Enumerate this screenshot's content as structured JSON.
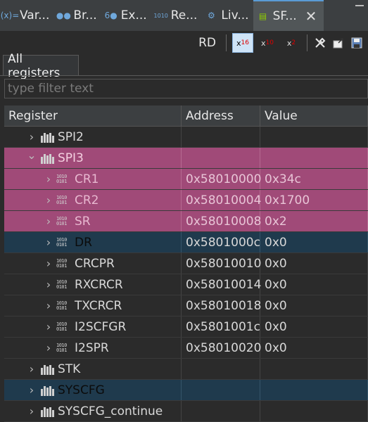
{
  "tabs": [
    {
      "label": "Var...",
      "icon": "(x)=",
      "active": false
    },
    {
      "label": "Br...",
      "icon": "●●",
      "active": false
    },
    {
      "label": "Ex...",
      "icon": "6●",
      "active": false
    },
    {
      "label": "Re...",
      "icon": "1010",
      "active": false
    },
    {
      "label": "Liv...",
      "icon": "⚙",
      "active": false
    },
    {
      "label": "SF...",
      "icon": "▤",
      "active": true
    }
  ],
  "toolbar": {
    "rd_label": "RD",
    "hex_label": "x",
    "hex_sub": "16",
    "dec_label": "x",
    "dec_sub": "10",
    "bin_label": "x",
    "bin_sub": "2"
  },
  "subtab": {
    "label": "All registers"
  },
  "filter": {
    "placeholder": "type filter text"
  },
  "columns": {
    "register": "Register",
    "address": "Address",
    "value": "Value"
  },
  "rows": [
    {
      "name": "SPI2",
      "address": "",
      "value": "",
      "level": 1,
      "expanded": false,
      "kind": "peripheral",
      "style": "normal"
    },
    {
      "name": "SPI3",
      "address": "",
      "value": "",
      "level": 1,
      "expanded": true,
      "kind": "peripheral",
      "style": "pink"
    },
    {
      "name": "CR1",
      "address": "0x58010000",
      "value": "0x34c",
      "level": 2,
      "kind": "register",
      "style": "pink"
    },
    {
      "name": "CR2",
      "address": "0x58010004",
      "value": "0x1700",
      "level": 2,
      "kind": "register",
      "style": "pink"
    },
    {
      "name": "SR",
      "address": "0x58010008",
      "value": "0x2",
      "level": 2,
      "kind": "register",
      "style": "pink"
    },
    {
      "name": "DR",
      "address": "0x5801000c",
      "value": "0x0",
      "level": 2,
      "kind": "register",
      "style": "blue"
    },
    {
      "name": "CRCPR",
      "address": "0x58010010",
      "value": "0x0",
      "level": 2,
      "kind": "register",
      "style": "normal"
    },
    {
      "name": "RXCRCR",
      "address": "0x58010014",
      "value": "0x0",
      "level": 2,
      "kind": "register",
      "style": "normal"
    },
    {
      "name": "TXCRCR",
      "address": "0x58010018",
      "value": "0x0",
      "level": 2,
      "kind": "register",
      "style": "normal"
    },
    {
      "name": "I2SCFGR",
      "address": "0x5801001c",
      "value": "0x0",
      "level": 2,
      "kind": "register",
      "style": "normal"
    },
    {
      "name": "I2SPR",
      "address": "0x58010020",
      "value": "0x0",
      "level": 2,
      "kind": "register",
      "style": "normal"
    },
    {
      "name": "STK",
      "address": "",
      "value": "",
      "level": 1,
      "expanded": false,
      "kind": "peripheral",
      "style": "normal"
    },
    {
      "name": "SYSCFG",
      "address": "",
      "value": "",
      "level": 1,
      "expanded": false,
      "kind": "peripheral",
      "style": "blue"
    },
    {
      "name": "SYSCFG_continue",
      "address": "",
      "value": "",
      "level": 1,
      "expanded": false,
      "kind": "peripheral",
      "style": "normal"
    }
  ]
}
